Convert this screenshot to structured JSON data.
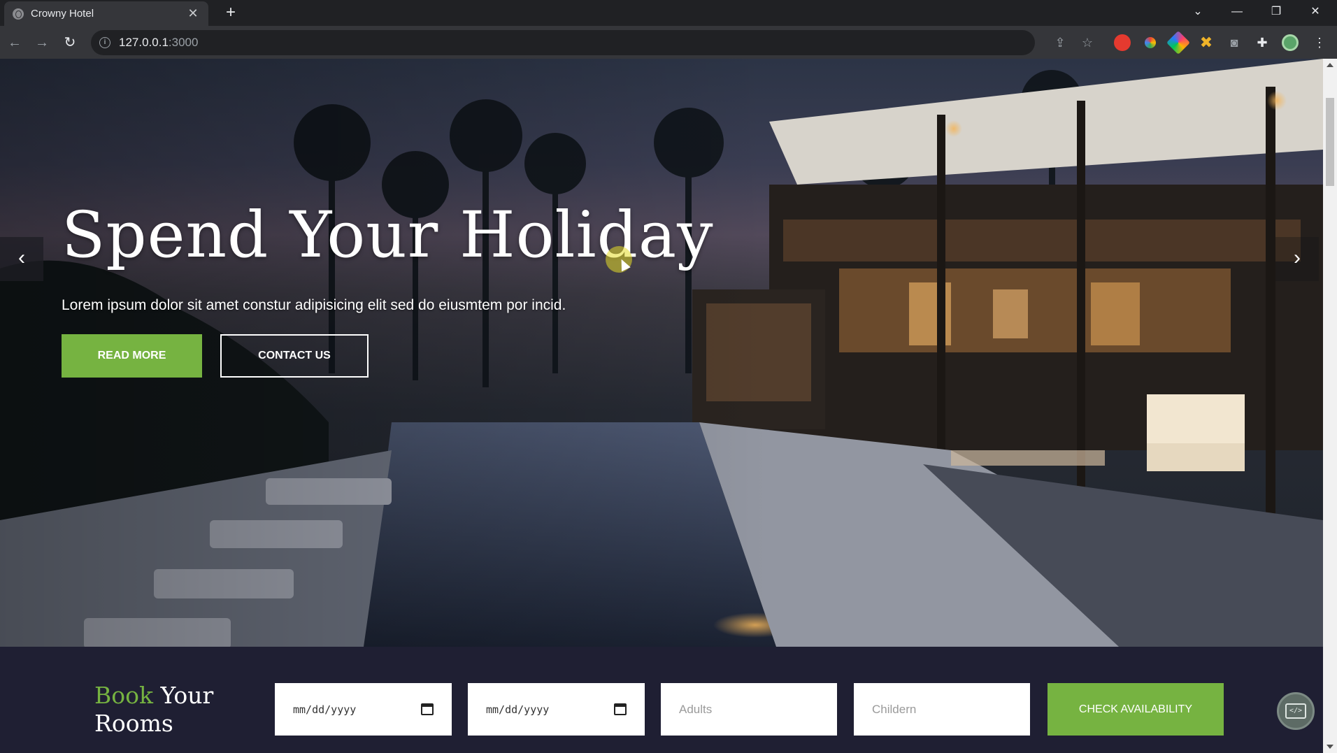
{
  "browser": {
    "tab_title": "Crowny Hotel",
    "tab_close": "✕",
    "new_tab": "+",
    "url_host": "127.0.0.1",
    "url_port": ":3000",
    "window_controls": {
      "minimize": "—",
      "restore": "❐",
      "close": "✕",
      "tab_search": "⌄"
    }
  },
  "hero": {
    "title": "Spend Your Holiday",
    "subtitle": "Lorem ipsum dolor sit amet constur adipisicing elit sed do eiusmtem por incid.",
    "read_more": "READ MORE",
    "contact_us": "CONTACT US",
    "prev_arrow": "‹",
    "next_arrow": "›"
  },
  "booking": {
    "title_accent": "Book",
    "title_rest": "Your Rooms",
    "checkin_value": "mm/dd/yyyy",
    "checkout_value": "mm/dd/yyyy",
    "adults_placeholder": "Adults",
    "children_placeholder": "Childern",
    "check_button": "CHECK AVAILABILITY"
  },
  "colors": {
    "accent": "#76b341",
    "booking_bg": "#1f1f33"
  }
}
